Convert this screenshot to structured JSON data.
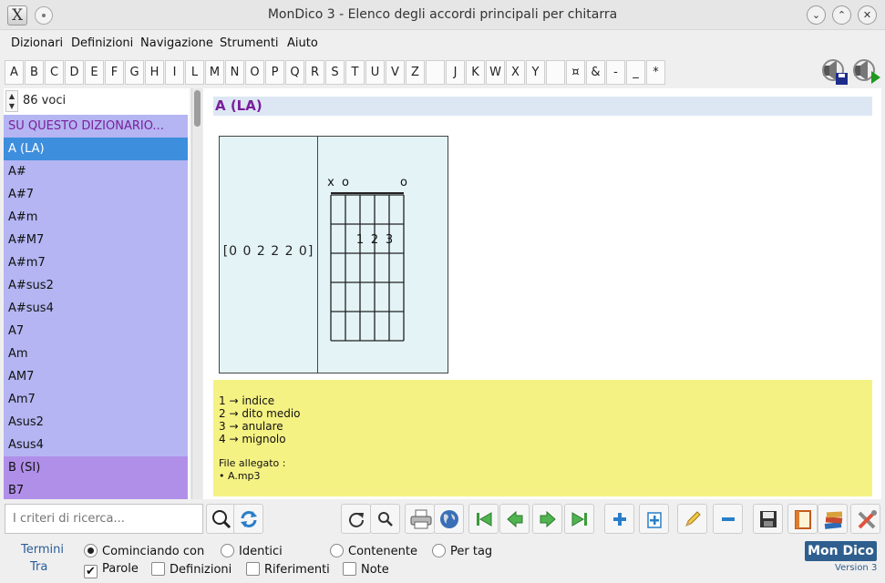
{
  "window": {
    "title": "MonDico 3 - Elenco degli accordi principali per chitarra",
    "app_icon_glyph": "X"
  },
  "menu": [
    "Dizionari",
    "Definizioni",
    "Navigazione",
    "Strumenti",
    "Aiuto"
  ],
  "letters": [
    "A",
    "B",
    "C",
    "D",
    "E",
    "F",
    "G",
    "H",
    "I",
    "L",
    "M",
    "N",
    "O",
    "P",
    "Q",
    "R",
    "S",
    "T",
    "U",
    "V",
    "Z",
    "",
    "J",
    "K",
    "W",
    "X",
    "Y",
    "",
    "¤",
    "&",
    "-",
    "_",
    "*"
  ],
  "sidebar": {
    "count": "86 voci",
    "header": "SU QUESTO DIZIONARIO...",
    "items": [
      "A (LA)",
      "A#",
      "A#7",
      "A#m",
      "A#M7",
      "A#m7",
      "A#sus2",
      "A#sus4",
      "A7",
      "Am",
      "AM7",
      "Am7",
      "Asus2",
      "Asus4",
      "B (SI)",
      "B7"
    ]
  },
  "entry": {
    "title": "A (LA)",
    "shape": "[0 0 2 2 2 0]",
    "open_strings": [
      "x",
      "o",
      "",
      "",
      "",
      "o"
    ],
    "fingers": [
      {
        "string": 3,
        "fret": 2,
        "label": "1"
      },
      {
        "string": 4,
        "fret": 2,
        "label": "2"
      },
      {
        "string": 5,
        "fret": 2,
        "label": "3"
      }
    ],
    "legend": [
      "1 → indice",
      "2 → dito medio",
      "3 → anulare",
      "4 → mignolo"
    ],
    "file_heading": "File allegato :",
    "file_name": "• A.mp3"
  },
  "search": {
    "placeholder": "I criteri di ricerca..."
  },
  "toolbar_icons": [
    "search-glass-icon",
    "refresh-icon",
    "reload-icon",
    "zoom-icon",
    "print-icon",
    "globe-icon",
    "first-icon",
    "previous-icon",
    "next-icon",
    "last-icon",
    "add-icon",
    "add-copy-icon",
    "edit-icon",
    "remove-icon",
    "save-icon",
    "book-icon",
    "books-icon",
    "tools-icon"
  ],
  "filters": {
    "termini_label": "Termini",
    "tra_label": "Tra",
    "match_options": [
      {
        "label": "Cominciando con",
        "checked": true
      },
      {
        "label": "Identici",
        "checked": false
      },
      {
        "label": "Contenente",
        "checked": false
      },
      {
        "label": "Per tag",
        "checked": false
      }
    ],
    "scope_options": [
      {
        "label": "Parole",
        "checked": true
      },
      {
        "label": "Definizioni",
        "checked": false
      },
      {
        "label": "Riferimenti",
        "checked": false
      },
      {
        "label": "Note",
        "checked": false
      }
    ]
  },
  "brand": {
    "name": "Mon Dico",
    "version": "Version 3"
  },
  "colors": {
    "selection": "#3e8ede",
    "list_bg": "#b4b5f2",
    "list_bg_b": "#b08fe8",
    "heading_text": "#7a1f9a",
    "legend_bg": "#f5f284",
    "brand_bg": "#2e5f8e"
  }
}
